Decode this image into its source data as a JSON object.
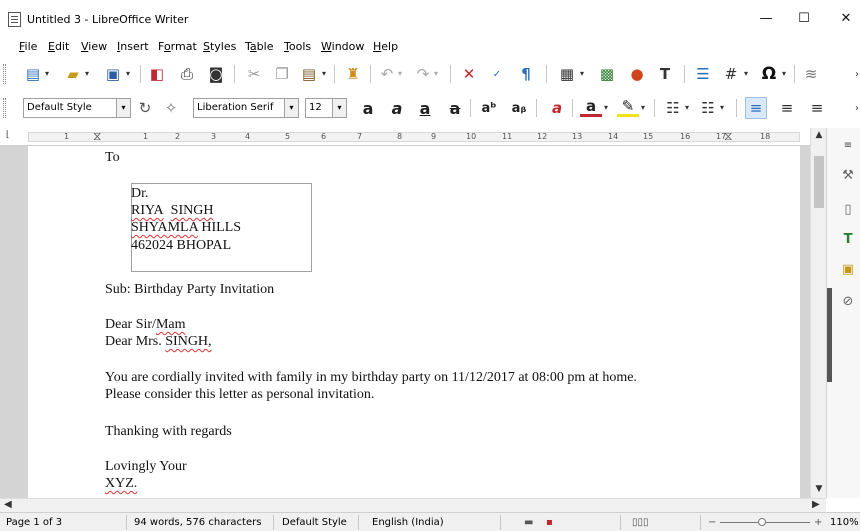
{
  "window": {
    "title": "Untitled 3 - LibreOffice Writer",
    "minimize": "—",
    "maximize": "☐",
    "close": "✕"
  },
  "menu": [
    {
      "label": "File",
      "u": "F",
      "rest": "ile"
    },
    {
      "label": "Edit",
      "u": "E",
      "rest": "dit"
    },
    {
      "label": "View",
      "u": "V",
      "rest": "iew"
    },
    {
      "label": "Insert",
      "u": "I",
      "rest": "nsert"
    },
    {
      "label": "Format",
      "pre": "F",
      "u": "o",
      "rest": "rmat"
    },
    {
      "label": "Styles",
      "u": "S",
      "rest": "tyles"
    },
    {
      "label": "Table",
      "pre": "T",
      "u": "a",
      "rest": "ble"
    },
    {
      "label": "Tools",
      "u": "T",
      "rest": "ools"
    },
    {
      "label": "Window",
      "u": "W",
      "rest": "indow"
    },
    {
      "label": "Help",
      "u": "H",
      "rest": "elp"
    }
  ],
  "formatting": {
    "paragraph_style": "Default Style",
    "font_name": "Liberation Serif",
    "font_size": "12"
  },
  "ruler": {
    "numbers": [
      "1",
      "1",
      "2",
      "3",
      "4",
      "5",
      "6",
      "7",
      "8",
      "9",
      "10",
      "11",
      "12",
      "13",
      "14",
      "15",
      "16",
      "17",
      "18"
    ]
  },
  "document": {
    "to": "To",
    "address": {
      "title": "Dr.",
      "name_first": "RIYA",
      "name_last": "SINGH",
      "street_a": "SHYAMLA",
      "street_b": "HILLS",
      "city": "462024 BHOPAL"
    },
    "subject": "Sub: Birthday Party Invitation",
    "salutation1_a": "Dear Sir/",
    "salutation1_b": "Mam",
    "salutation2_a": "Dear Mrs. ",
    "salutation2_b": "SINGH,",
    "body1": "You are cordially invited with family in my birthday party on 11/12/2017 at 08:00 pm at home.",
    "body2": "Please consider this letter as personal invitation.",
    "thanks": "Thanking with regards",
    "closing": "Lovingly Your",
    "signature": "XYZ."
  },
  "status": {
    "page": "Page 1 of 3",
    "words": "94 words, 576 characters",
    "page_style": "Default Style",
    "language": "English (India)",
    "zoom": "110%"
  },
  "colors": {
    "accent": "#2a6ebb",
    "spell": "#d33333"
  }
}
